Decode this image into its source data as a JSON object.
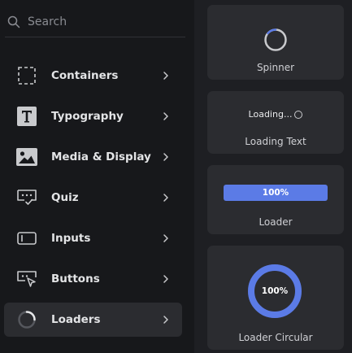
{
  "search": {
    "placeholder": "Search"
  },
  "sidebar": {
    "items": [
      {
        "label": "Containers",
        "icon": "dashed-square-icon"
      },
      {
        "label": "Typography",
        "icon": "text-t-icon"
      },
      {
        "label": "Media & Display",
        "icon": "image-icon"
      },
      {
        "label": "Quiz",
        "icon": "chat-check-icon"
      },
      {
        "label": "Inputs",
        "icon": "input-field-icon"
      },
      {
        "label": "Buttons",
        "icon": "button-cursor-icon"
      },
      {
        "label": "Loaders",
        "icon": "loader-ring-icon",
        "active": true
      }
    ]
  },
  "components": {
    "spinner": {
      "title": "Spinner"
    },
    "loading_text": {
      "title": "Loading Text",
      "preview": "Loading..."
    },
    "loader": {
      "title": "Loader",
      "value": "100%",
      "progress": 1.0
    },
    "loader_circular": {
      "title": "Loader Circular",
      "value": "100%",
      "progress": 1.0
    }
  },
  "colors": {
    "accent": "#5b7be6",
    "sidebar_bg": "#17181b",
    "card_bg": "#2b2c30"
  }
}
